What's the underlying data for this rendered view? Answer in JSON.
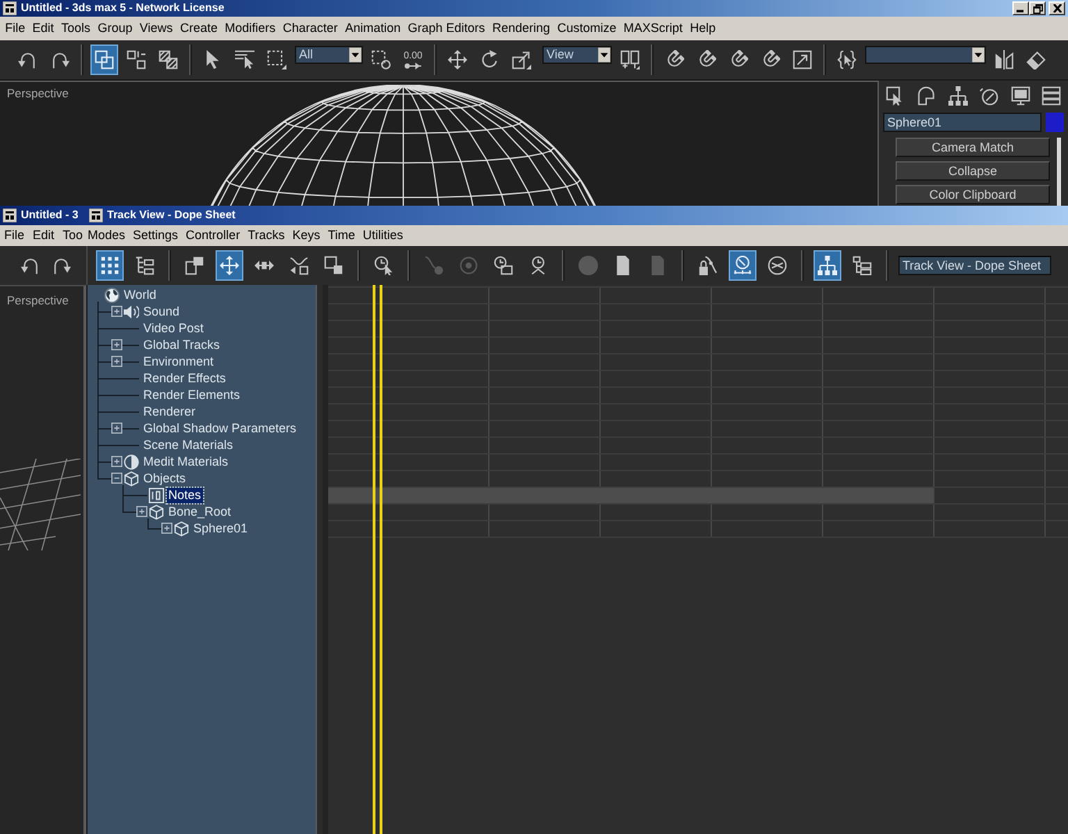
{
  "main_window": {
    "title": "Untitled - 3ds max 5 - Network License",
    "menu": [
      "File",
      "Edit",
      "Tools",
      "Group",
      "Views",
      "Create",
      "Modifiers",
      "Character",
      "Animation",
      "Graph Editors",
      "Rendering",
      "Customize",
      "MAXScript",
      "Help"
    ],
    "toolbar": [
      [
        {
          "kind": "button",
          "selected": false
        },
        {
          "kind": "button",
          "selected": false
        }
      ],
      [
        {
          "kind": "button",
          "selected": true
        },
        {
          "kind": "button",
          "selected": false
        },
        {
          "kind": "button",
          "selected": false
        }
      ],
      [
        {
          "kind": "button",
          "selected": false
        },
        {
          "kind": "button",
          "selected": false
        },
        {
          "kind": "button",
          "selected": false
        },
        {
          "kind": "dropdown",
          "value": "All"
        },
        {
          "kind": "button",
          "selected": false
        },
        {
          "kind": "button",
          "selected": false,
          "label": "0.00"
        }
      ],
      [
        {
          "kind": "button",
          "selected": false
        },
        {
          "kind": "button",
          "selected": false
        },
        {
          "kind": "button",
          "selected": false
        },
        {
          "kind": "dropdown",
          "value": "View"
        },
        {
          "kind": "button",
          "selected": false
        }
      ],
      [
        {
          "kind": "button",
          "selected": false
        },
        {
          "kind": "button",
          "selected": false
        },
        {
          "kind": "button",
          "selected": false
        },
        {
          "kind": "button",
          "selected": false
        },
        {
          "kind": "button",
          "selected": false
        }
      ],
      [
        {
          "kind": "button",
          "selected": false
        },
        {
          "kind": "dropdown"
        },
        {
          "kind": "button",
          "selected": false
        },
        {
          "kind": "button",
          "selected": false
        }
      ]
    ],
    "viewport": {
      "label": "Perspective"
    },
    "command_panel": {
      "object": {
        "name": "Sphere01",
        "color": "#1c1cc8"
      },
      "buttons": [
        "Camera Match",
        "Collapse",
        "Color Clipboard"
      ]
    }
  },
  "back_window": {
    "title": "Untitled - 3",
    "menu": [
      "File",
      "Edit",
      "Too"
    ],
    "toolbar": [
      [
        {
          "kind": "button",
          "selected": false
        },
        {
          "kind": "button",
          "selected": false
        }
      ]
    ],
    "viewport": {
      "label": "Perspective"
    }
  },
  "track_view": {
    "title": "Track View - Dope Sheet",
    "menu": [
      "Modes",
      "Settings",
      "Controller",
      "Tracks",
      "Keys",
      "Time",
      "Utilities"
    ],
    "toolbar": [
      [
        {
          "kind": "button",
          "selected": true,
          "disabled": false
        },
        {
          "kind": "button",
          "selected": false,
          "disabled": false
        }
      ],
      [
        {
          "kind": "button",
          "selected": false,
          "disabled": false
        },
        {
          "kind": "button",
          "selected": true,
          "disabled": false
        },
        {
          "kind": "button",
          "selected": false,
          "disabled": false
        },
        {
          "kind": "button",
          "selected": false,
          "disabled": false
        },
        {
          "kind": "button",
          "selected": false,
          "disabled": false
        }
      ],
      [
        {
          "kind": "button",
          "selected": false,
          "disabled": false
        }
      ],
      [
        {
          "kind": "button",
          "selected": false,
          "disabled": true
        },
        {
          "kind": "button",
          "selected": false,
          "disabled": true
        },
        {
          "kind": "button",
          "selected": false,
          "disabled": false
        },
        {
          "kind": "button",
          "selected": false,
          "disabled": false
        }
      ],
      [
        {
          "kind": "button",
          "selected": false,
          "disabled": true
        },
        {
          "kind": "button",
          "selected": false,
          "disabled": false
        },
        {
          "kind": "button",
          "selected": false,
          "disabled": true
        }
      ],
      [
        {
          "kind": "button",
          "selected": false,
          "disabled": false
        },
        {
          "kind": "button",
          "selected": true,
          "disabled": false
        },
        {
          "kind": "button",
          "selected": false,
          "disabled": false
        }
      ],
      [
        {
          "kind": "button",
          "selected": true,
          "disabled": false
        },
        {
          "kind": "button",
          "selected": false,
          "disabled": false
        }
      ]
    ],
    "name_field": "Track View - Dope Sheet",
    "tree": [
      {
        "label": "World",
        "kind": "world",
        "selected": false,
        "children": [
          {
            "label": "Sound",
            "kind": "sound",
            "selected": false,
            "expanded": false
          },
          {
            "label": "Video Post",
            "kind": "track",
            "selected": false
          },
          {
            "label": "Global Tracks",
            "kind": "track",
            "selected": false,
            "expanded": false
          },
          {
            "label": "Environment",
            "kind": "track",
            "selected": false,
            "expanded": false
          },
          {
            "label": "Render Effects",
            "kind": "track",
            "selected": false
          },
          {
            "label": "Render Elements",
            "kind": "track",
            "selected": false
          },
          {
            "label": "Renderer",
            "kind": "track",
            "selected": false
          },
          {
            "label": "Global Shadow Parameters",
            "kind": "track",
            "selected": false,
            "expanded": false
          },
          {
            "label": "Scene Materials",
            "kind": "track",
            "selected": false
          },
          {
            "label": "Medit Materials",
            "kind": "material",
            "selected": false,
            "expanded": false
          },
          {
            "label": "Objects",
            "kind": "object",
            "selected": false,
            "expanded": true,
            "children": [
              {
                "label": "Notes",
                "kind": "notes",
                "selected": true
              },
              {
                "label": "Bone_Root",
                "kind": "object",
                "selected": false,
                "expanded": false,
                "children": [
                  {
                    "label": "Sphere01",
                    "kind": "object",
                    "selected": false,
                    "expanded": false
                  }
                ]
              }
            ]
          }
        ]
      }
    ],
    "time_slider": {
      "level": 0.06
    }
  }
}
